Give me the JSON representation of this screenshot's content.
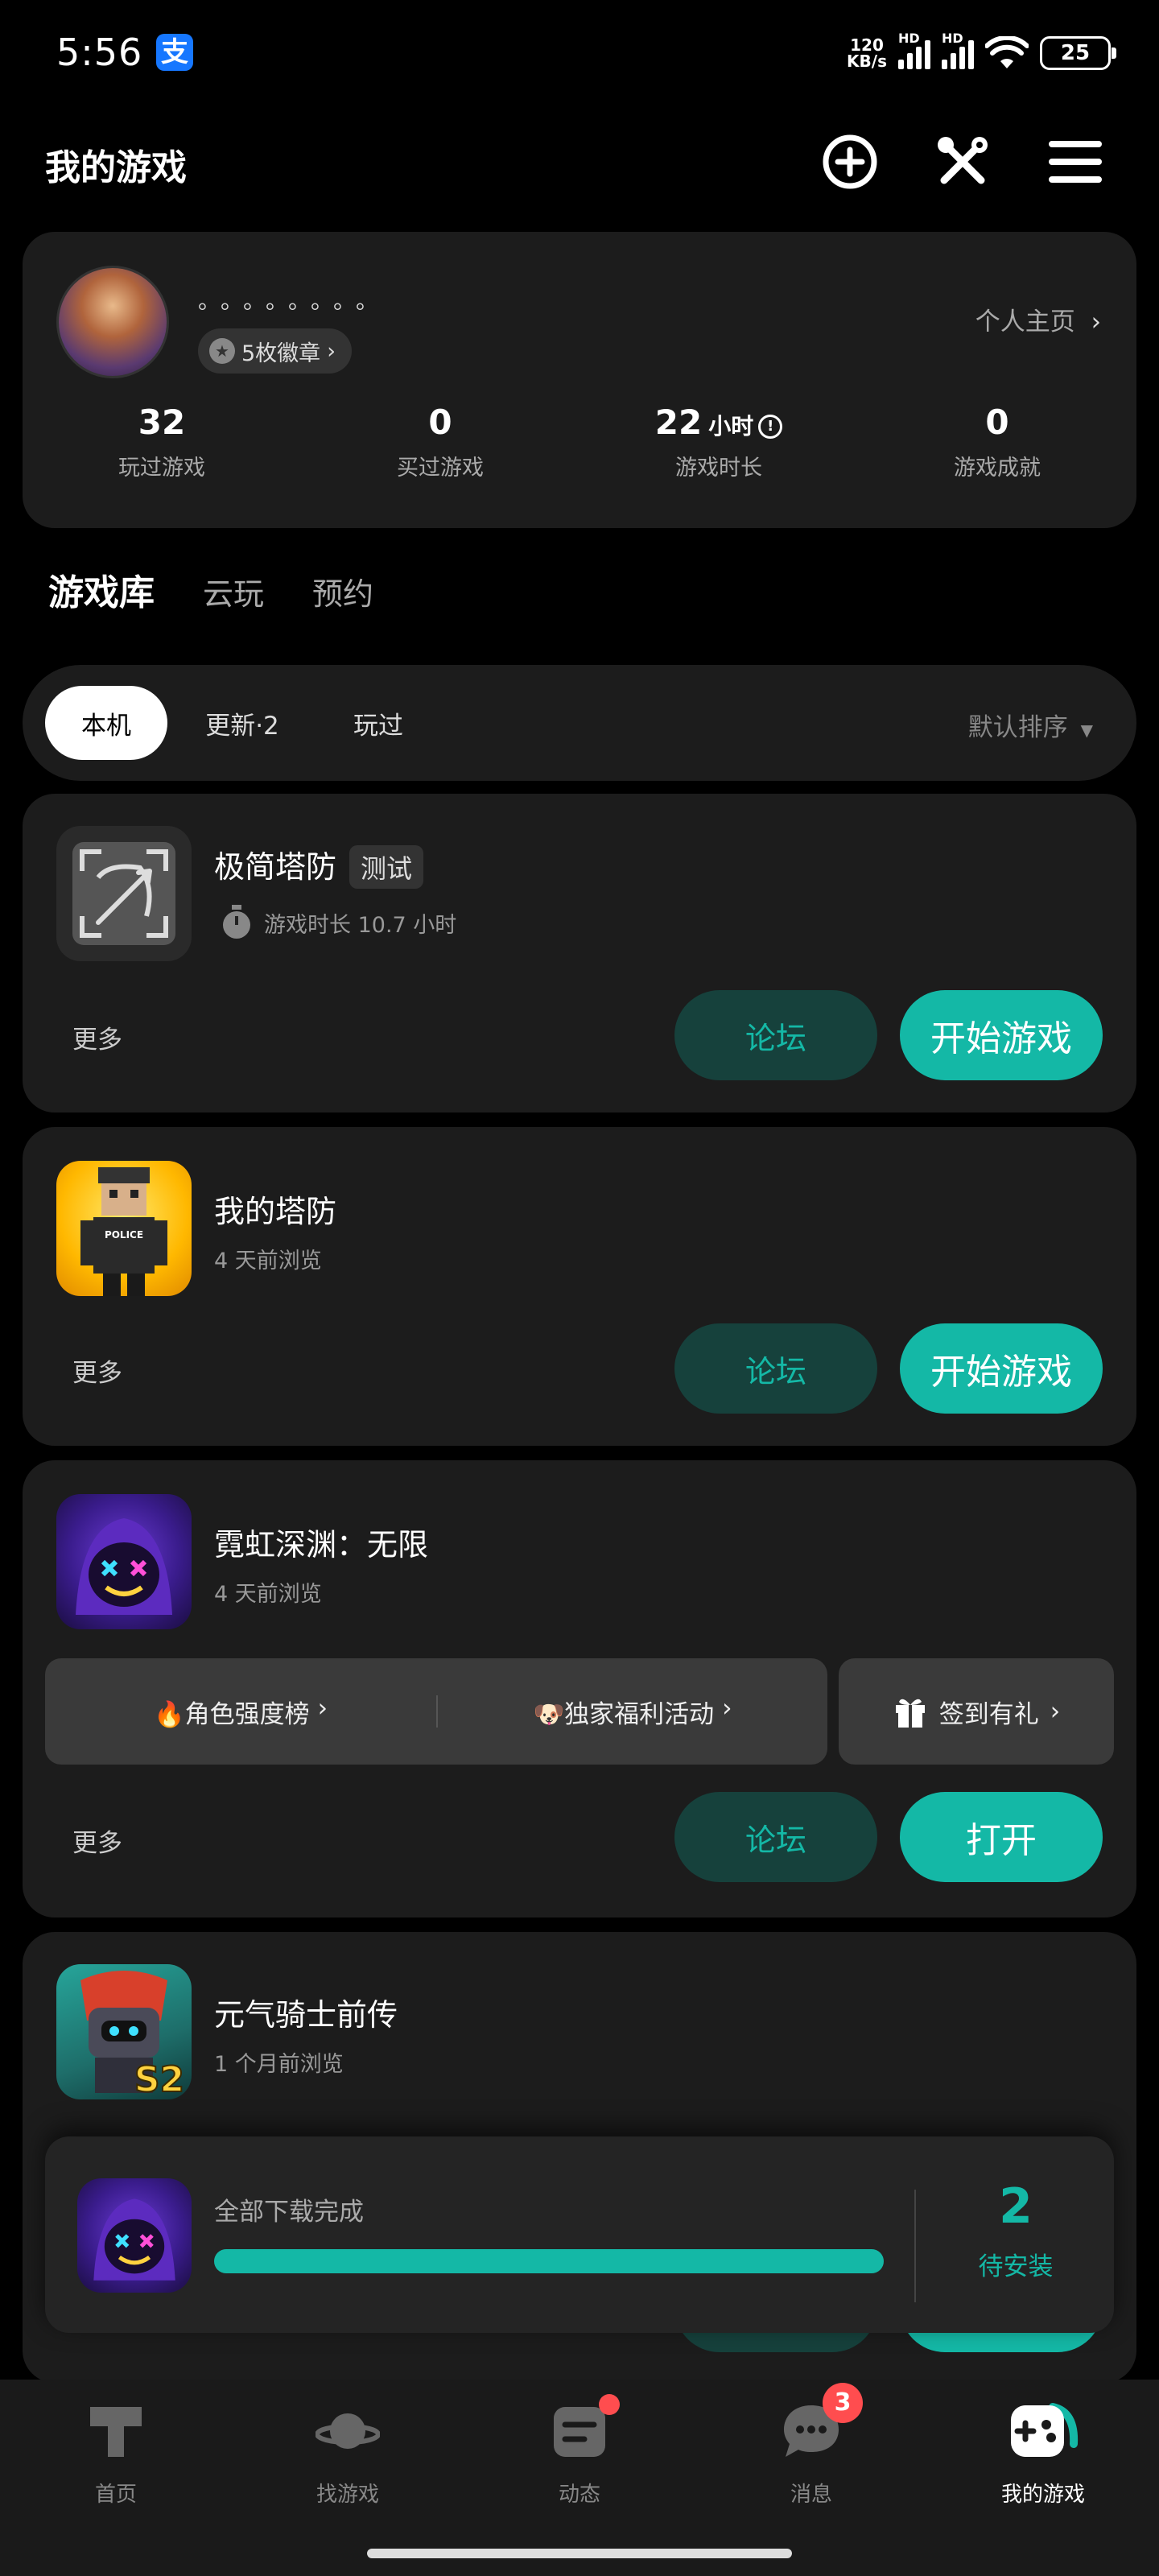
{
  "status": {
    "time": "5:56",
    "app_badge": "支",
    "net_speed_top": "120",
    "net_speed_bottom": "KB/s",
    "hd1": "HD",
    "hd2": "HD",
    "battery": "25"
  },
  "header": {
    "title": "我的游戏"
  },
  "profile": {
    "nickname": "。。。。。。。。",
    "badge_label": "5枚徽章",
    "profile_link": "个人主页",
    "stats": [
      {
        "value": "32",
        "unit": "",
        "label": "玩过游戏"
      },
      {
        "value": "0",
        "unit": "",
        "label": "买过游戏"
      },
      {
        "value": "22",
        "unit": "小时",
        "label": "游戏时长"
      },
      {
        "value": "0",
        "unit": "",
        "label": "游戏成就"
      }
    ]
  },
  "tabs": [
    "游戏库",
    "云玩",
    "预约"
  ],
  "filters": {
    "items": [
      "本机",
      "更新·2",
      "玩过"
    ],
    "sort": "默认排序"
  },
  "games": [
    {
      "name": "极简塔防",
      "tag": "测试",
      "sub": "游戏时长 10.7 小时",
      "more": "更多",
      "forum": "论坛",
      "action": "开始游戏"
    },
    {
      "name": "我的塔防",
      "sub": "4 天前浏览",
      "more": "更多",
      "forum": "论坛",
      "action": "开始游戏",
      "icon_text": "POLICE"
    },
    {
      "name": "霓虹深渊：无限",
      "sub": "4 天前浏览",
      "more": "更多",
      "forum": "论坛",
      "action": "打开",
      "promos": [
        "🔥角色强度榜",
        "🐶独家福利活动",
        "签到有礼"
      ]
    },
    {
      "name": "元气骑士前传",
      "sub": "1 个月前浏览",
      "icon_text": "S2"
    }
  ],
  "download": {
    "status": "全部下载完成",
    "count": "2",
    "count_label": "待安装",
    "progress": 1.0
  },
  "nav": [
    "首页",
    "找游戏",
    "动态",
    "消息",
    "我的游戏"
  ],
  "nav_message_badge": "3",
  "accent_color": "#14b8a6"
}
